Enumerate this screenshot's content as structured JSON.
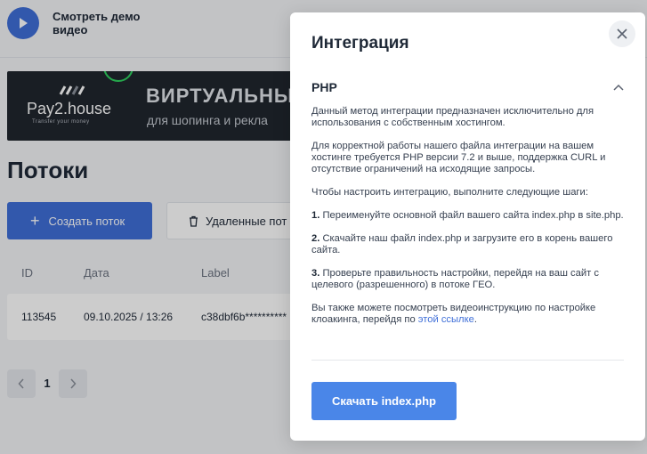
{
  "demo": {
    "label": "Смотреть демо видео"
  },
  "banner": {
    "logo": "Pay2.house",
    "logo_tagline": "Transfer your money",
    "headline": "ВИРТУАЛЬНЫ",
    "subline": "для шопинга и рекла"
  },
  "page": {
    "title": "Потоки",
    "create_button": "Создать поток",
    "deleted_button": "Удаленные пот"
  },
  "table": {
    "headers": [
      "ID",
      "Дата",
      "Label"
    ],
    "rows": [
      {
        "id": "113545",
        "date": "09.10.2025 / 13:26",
        "label": "c38dbf6b**********"
      }
    ]
  },
  "pagination": {
    "current": "1"
  },
  "modal": {
    "title": "Интеграция",
    "section_title": "PHP",
    "p1": "Данный метод интеграции предназначен исключительно для использования с собственным хостингом.",
    "p2": "Для корректной работы нашего файла интеграции на вашем хостинге требуется PHP версии 7.2 и выше, поддержка CURL и отсутствие ограничений на исходящие запросы.",
    "p3": "Чтобы настроить интеграцию, выполните следующие шаги:",
    "step1_num": "1.",
    "step1": "Переименуйте основной файл вашего сайта index.php в site.php.",
    "step2_num": "2.",
    "step2": "Скачайте наш файл index.php и загрузите его в корень вашего сайта.",
    "step3_num": "3.",
    "step3": "Проверьте правильность настройки, перейдя на ваш сайт с целевого (разрешенного) в потоке ГЕО.",
    "video_text": "Вы также можете посмотреть видеоинструкцию по настройке клоакинга, перейдя по",
    "video_link": "этой ссылке",
    "video_end": ".",
    "download_button": "Скачать index.php"
  },
  "colors": {
    "accent": "#3f6fd8",
    "download": "#4a86e8",
    "link": "#3f6fd8"
  },
  "icons": {
    "play": "play-icon",
    "plus": "plus-icon",
    "trash": "trash-icon",
    "close": "close-icon",
    "chevron": "chevron-up-icon"
  }
}
